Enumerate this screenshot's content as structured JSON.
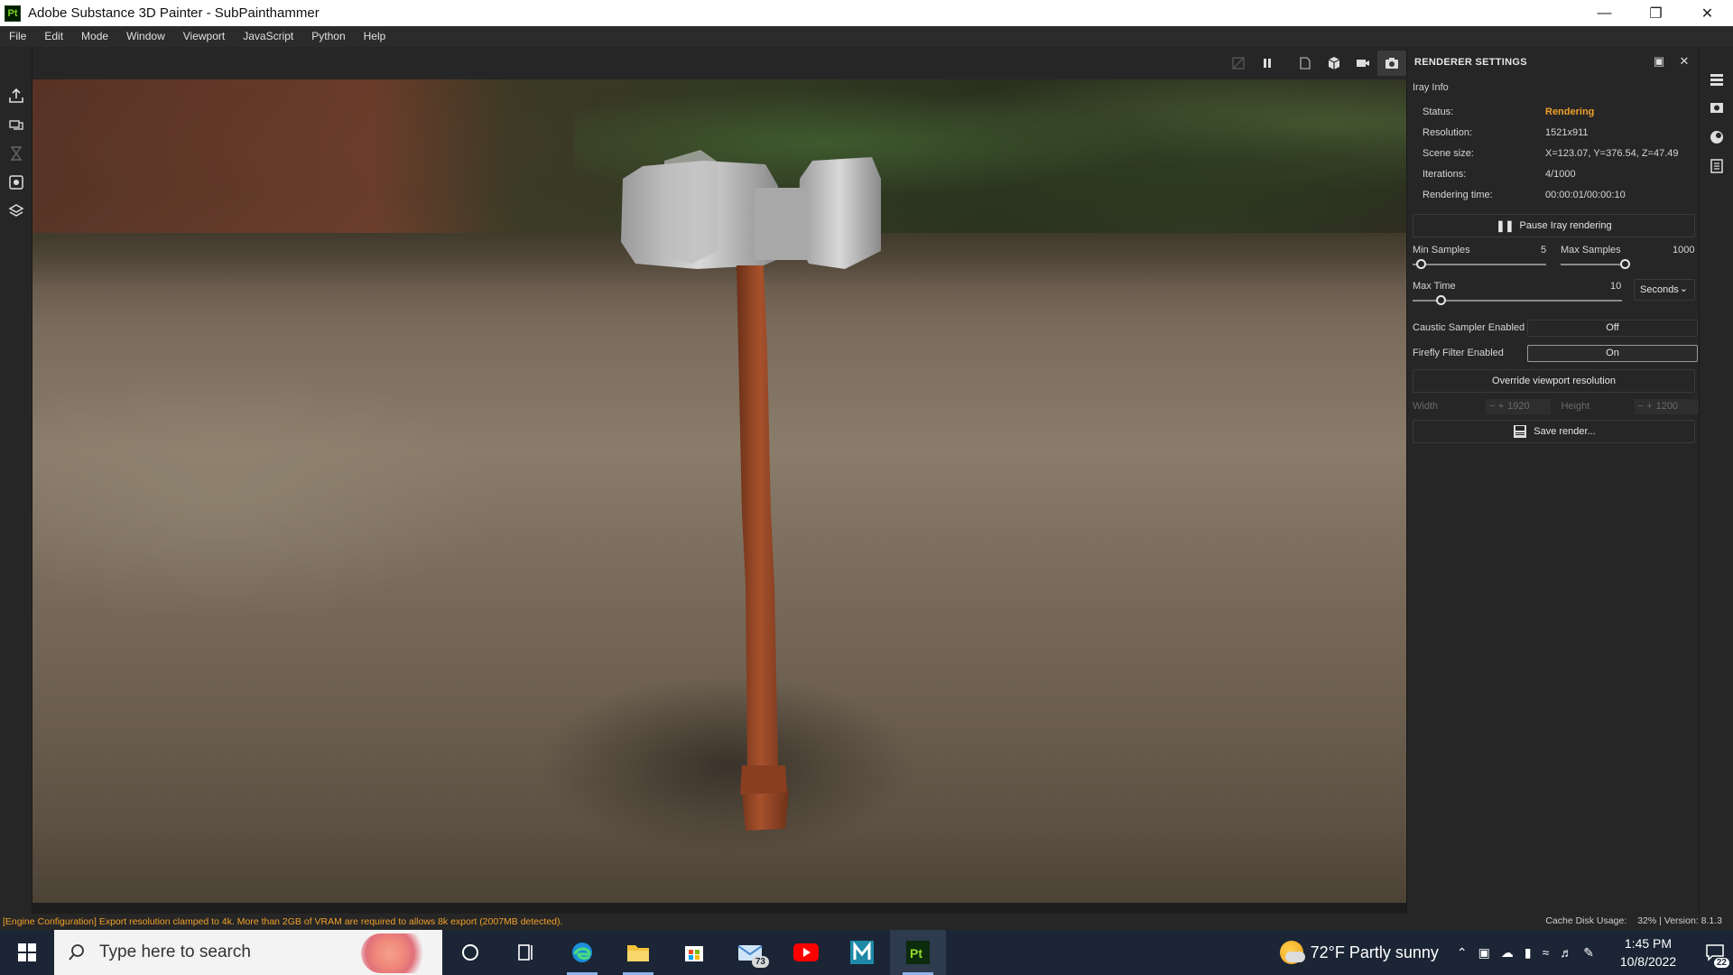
{
  "window": {
    "title": "Adobe Substance 3D Painter - SubPainthammer",
    "logo": "Pt",
    "controls": [
      "minimize",
      "restore",
      "close"
    ]
  },
  "menu": [
    "File",
    "Edit",
    "Mode",
    "Window",
    "Viewport",
    "JavaScript",
    "Python",
    "Help"
  ],
  "viewport_toolbar": {
    "icons": [
      "hide-icon",
      "pause-icon",
      "frame-icon",
      "cube-icon",
      "camera-icon",
      "screenshot-icon"
    ]
  },
  "renderer": {
    "title": "RENDERER SETTINGS",
    "iray_info_label": "Iray Info",
    "info": [
      {
        "key": "Status:",
        "value": "Rendering",
        "accent": true
      },
      {
        "key": "Resolution:",
        "value": "1521x911"
      },
      {
        "key": "Scene size:",
        "value": "X=123.07, Y=376.54, Z=47.49"
      },
      {
        "key": "Iterations:",
        "value": "4/1000"
      },
      {
        "key": "Rendering time:",
        "value": "00:00:01/00:00:10"
      }
    ],
    "pause_button": "Pause Iray rendering",
    "min_samples": {
      "label": "Min Samples",
      "value": "5",
      "fraction": 0.0
    },
    "max_samples": {
      "label": "Max Samples",
      "value": "1000",
      "fraction": 1.0
    },
    "max_time": {
      "label": "Max Time",
      "value": "10",
      "fraction": 0.0,
      "unit": "Seconds"
    },
    "caustic": {
      "label": "Caustic Sampler Enabled",
      "value": "Off"
    },
    "firefly": {
      "label": "Firefly Filter Enabled",
      "value": "On"
    },
    "override_button": "Override viewport resolution",
    "width": {
      "label": "Width",
      "value": "1920"
    },
    "height": {
      "label": "Height",
      "value": "1200"
    },
    "save_button": "Save render..."
  },
  "status": {
    "message": "[Engine Configuration] Export resolution clamped to 4k. More than 2GB of VRAM are required to allows 8k export (2007MB detected).",
    "cache_label": "Cache Disk Usage:",
    "cache_value": "32% | Version: 8.1.3"
  },
  "taskbar": {
    "search_placeholder": "Type here to search",
    "mail_badge": "73",
    "weather": "72°F  Partly sunny",
    "time": "1:45 PM",
    "date": "10/8/2022",
    "notifications": "22",
    "apps": [
      "cortana-icon",
      "task-view-icon",
      "edge-icon",
      "file-explorer-icon",
      "store-icon",
      "mail-icon",
      "youtube-icon",
      "maya-icon",
      "substance-painter-icon"
    ]
  }
}
